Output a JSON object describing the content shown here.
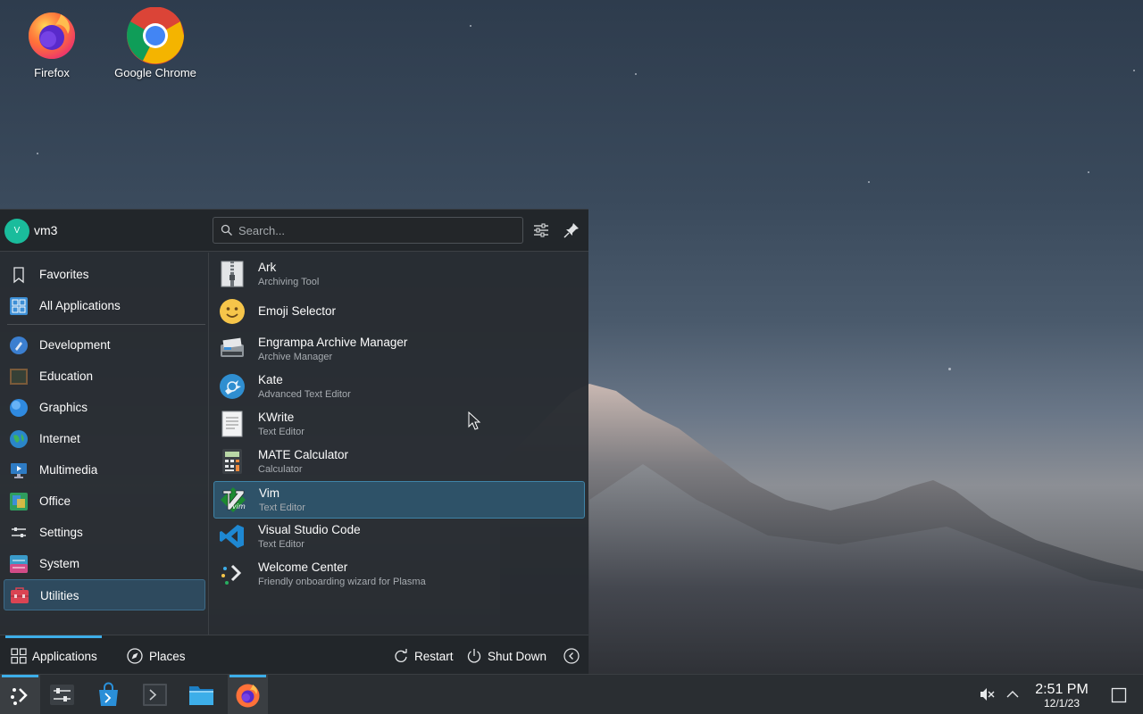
{
  "desktop": {
    "icons": [
      {
        "label": "Firefox",
        "icon": "firefox-icon"
      },
      {
        "label": "Google Chrome",
        "icon": "chrome-icon"
      }
    ]
  },
  "launcher": {
    "user": {
      "name": "vm3",
      "avatar_letter": "V"
    },
    "search": {
      "placeholder": "Search..."
    },
    "categories": [
      {
        "label": "Favorites",
        "icon": "bookmark-icon"
      },
      {
        "label": "All Applications",
        "icon": "grid-icon"
      },
      {
        "label": "Development",
        "icon": "development-icon"
      },
      {
        "label": "Education",
        "icon": "education-icon"
      },
      {
        "label": "Graphics",
        "icon": "graphics-icon"
      },
      {
        "label": "Internet",
        "icon": "internet-icon"
      },
      {
        "label": "Multimedia",
        "icon": "multimedia-icon"
      },
      {
        "label": "Office",
        "icon": "office-icon"
      },
      {
        "label": "Settings",
        "icon": "settings-icon"
      },
      {
        "label": "System",
        "icon": "system-icon"
      },
      {
        "label": "Utilities",
        "icon": "utilities-icon",
        "selected": true
      }
    ],
    "apps": [
      {
        "name": "Ark",
        "desc": "Archiving Tool",
        "icon": "ark-icon"
      },
      {
        "name": "Emoji Selector",
        "desc": "",
        "icon": "emoji-icon"
      },
      {
        "name": "Engrampa Archive Manager",
        "desc": "Archive Manager",
        "icon": "engrampa-icon"
      },
      {
        "name": "Kate",
        "desc": "Advanced Text Editor",
        "icon": "kate-icon"
      },
      {
        "name": "KWrite",
        "desc": "Text Editor",
        "icon": "kwrite-icon"
      },
      {
        "name": "MATE Calculator",
        "desc": "Calculator",
        "icon": "calculator-icon"
      },
      {
        "name": "Vim",
        "desc": "Text Editor",
        "icon": "vim-icon",
        "selected": true
      },
      {
        "name": "Visual Studio Code",
        "desc": "Text Editor",
        "icon": "vscode-icon"
      },
      {
        "name": "Welcome Center",
        "desc": "Friendly onboarding wizard for Plasma",
        "icon": "welcome-icon"
      }
    ],
    "footer": {
      "applications_label": "Applications",
      "places_label": "Places",
      "restart_label": "Restart",
      "shutdown_label": "Shut Down"
    }
  },
  "taskbar": {
    "items": [
      "app-launcher-icon",
      "settings-icon",
      "discover-icon",
      "konsole-icon",
      "dolphin-icon",
      "firefox-icon"
    ],
    "clock": {
      "time": "2:51 PM",
      "date": "12/1/23"
    }
  },
  "colors": {
    "accent": "#3daee9",
    "selection": "#2e5268",
    "panel": "#2a2e32"
  }
}
